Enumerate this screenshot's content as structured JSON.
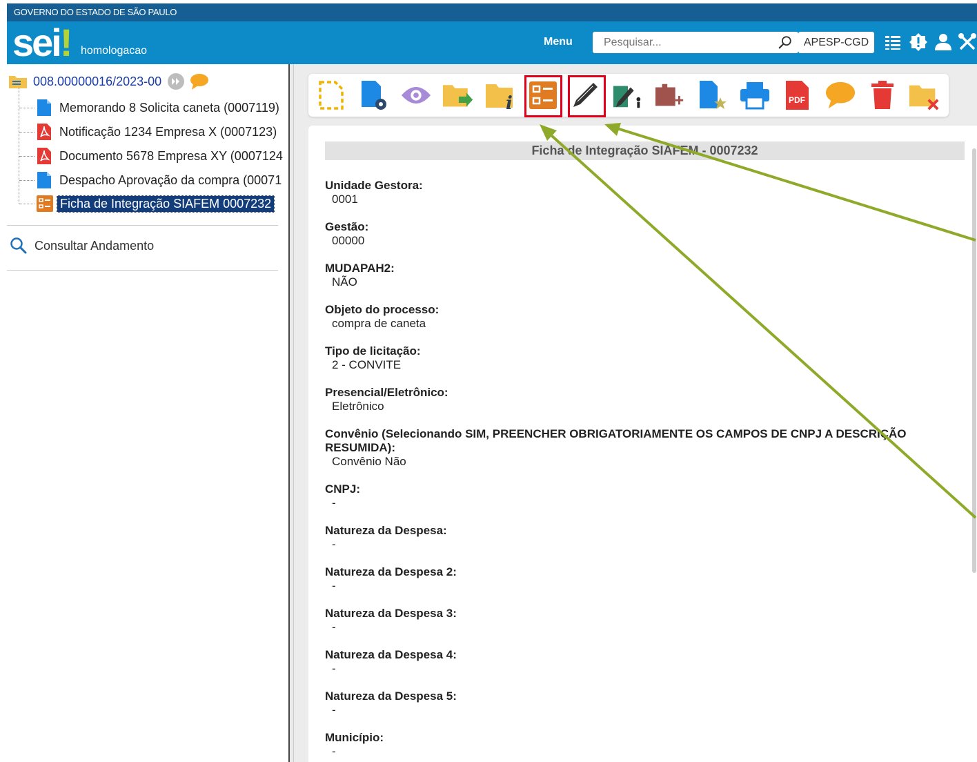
{
  "header": {
    "gov_label": "GOVERNO DO ESTADO DE SÃO PAULO",
    "logo_text": "sei",
    "logo_mark": "!",
    "environment": "homologacao",
    "menu_label": "Menu",
    "search_placeholder": "Pesquisar...",
    "unit": "APESP-CGD",
    "icons": [
      "list-icon",
      "alert-icon",
      "user-icon",
      "tools-icon"
    ]
  },
  "tree": {
    "process_number": "008.00000016/2023-00",
    "documents": [
      {
        "label": "Memorando 8 Solicita caneta (0007119)",
        "type": "internal"
      },
      {
        "label": "Notificação 1234 Empresa X (0007123)",
        "type": "pdf"
      },
      {
        "label": "Documento 5678 Empresa XY (0007124",
        "type": "pdf"
      },
      {
        "label": "Despacho Aprovação da compra (00071",
        "type": "internal"
      },
      {
        "label": "Ficha de Integração SIAFEM 0007232",
        "type": "form"
      }
    ],
    "consult_label": "Consultar Andamento"
  },
  "toolbar": {
    "icons": [
      "new-document-icon",
      "document-settings-icon",
      "view-icon",
      "send-process-icon",
      "process-info-icon",
      "form-icon",
      "edit-icon",
      "sign-icon",
      "attach-icon",
      "favorite-document-icon",
      "print-icon",
      "pdf-icon",
      "comment-icon",
      "delete-icon",
      "close-process-icon"
    ],
    "pdf_label": "PDF"
  },
  "document": {
    "title": "Ficha de Integração SIAFEM - 0007232",
    "fields": [
      {
        "label": "Unidade Gestora:",
        "value": "0001"
      },
      {
        "label": "Gestão:",
        "value": "00000"
      },
      {
        "label": "MUDAPAH2:",
        "value": "NÃO"
      },
      {
        "label": "Objeto do processo:",
        "value": "compra de caneta"
      },
      {
        "label": "Tipo de licitação:",
        "value": "2 - CONVITE"
      },
      {
        "label": "Presencial/Eletrônico:",
        "value": "Eletrônico"
      },
      {
        "label": "Convênio (Selecionando SIM, PREENCHER OBRIGATORIAMENTE OS CAMPOS DE CNPJ A DESCRIÇÃO RESUMIDA):",
        "value": "Convênio Não"
      },
      {
        "label": "CNPJ:",
        "value": "-"
      },
      {
        "label": "Natureza da Despesa:",
        "value": "-"
      },
      {
        "label": "Natureza da Despesa 2:",
        "value": "-"
      },
      {
        "label": "Natureza da Despesa 3:",
        "value": "-"
      },
      {
        "label": "Natureza da Despesa 4:",
        "value": "-"
      },
      {
        "label": "Natureza da Despesa 5:",
        "value": "-"
      },
      {
        "label": "Município:",
        "value": "-"
      }
    ]
  },
  "colors": {
    "gov_bar": "#155f94",
    "header": "#0d8ac8",
    "highlight": "#e0001a",
    "arrow": "#8faa2a",
    "selected": "#123c7a"
  }
}
